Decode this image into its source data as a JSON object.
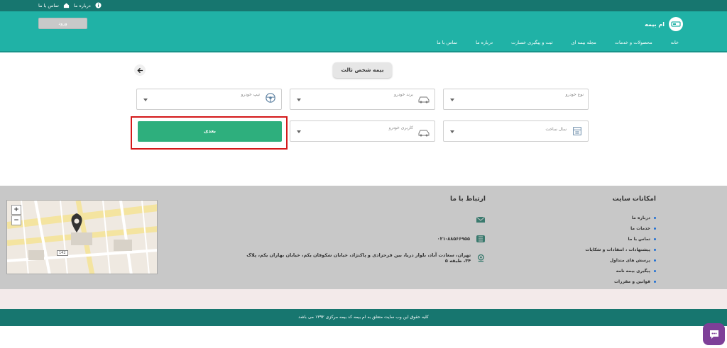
{
  "topbar": {
    "about_label": "درباره ما",
    "contact_label": "تماس با ما"
  },
  "header": {
    "login_label": "ورود",
    "brand_name": "ام بیمه",
    "nav": [
      "خانه",
      "محصولات و خدمات",
      "مجله بیمه ای",
      "ثبت و پیگیری خسارت",
      "درباره ما",
      "تماس با ما"
    ]
  },
  "main": {
    "page_title": "بیمه شخص ثالث",
    "fields": {
      "vehicle_type": "نوع خودرو",
      "vehicle_brand": "برند خودرو",
      "vehicle_model": "تیپ خودرو",
      "production_year": "سال ساخت",
      "vehicle_usage": "کاربری خودرو"
    },
    "next_label": "بعدی"
  },
  "footer": {
    "features_title": "امکانات سایت",
    "features": [
      "درباره ما",
      "خدمات ما",
      "تماس با ما",
      "پیشنهادات ، انتقادات و شکایات",
      "پرسش های متداول",
      "پیگیری بیمه نامه",
      "قوانین و مقررات"
    ],
    "contact_title": "ارتباط با ما",
    "phone": "۰۲۱-۸۸۵۶۶۹۵۵",
    "address": "تهران، سعادت آباد، بلوار دریا، بین فرحزادی و پاکنژاد، خیابان شکوفان یکم، خیابان بهاران یکم، پلاک ۳۴، طبقه ۵",
    "map": {
      "zoom_in": "+",
      "zoom_out": "−",
      "street_number": "142"
    },
    "copyright": "کلیه حقوق این وب سایت متعلق به ام بیمه کد بیمه مرکزی ۱۳۹۲ می باشد"
  },
  "colors": {
    "topbar": "#17766f",
    "header": "#20b2a6",
    "next_button": "#2eaf7d",
    "highlight": "#d4191a",
    "chat": "#7e3f98"
  }
}
